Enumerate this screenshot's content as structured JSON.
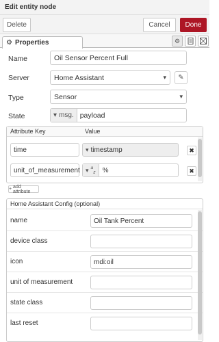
{
  "header": {
    "title": "Edit entity node"
  },
  "toolbar": {
    "delete_label": "Delete",
    "cancel_label": "Cancel",
    "done_label": "Done"
  },
  "tabs": {
    "properties_label": "Properties",
    "properties_icon": "gear-icon"
  },
  "form": {
    "name": {
      "label": "Name",
      "value": "Oil Sensor Percent Full"
    },
    "server": {
      "label": "Server",
      "value": "Home Assistant"
    },
    "type": {
      "label": "Type",
      "value": "Sensor"
    },
    "state": {
      "label": "State",
      "type_tag": "msg.",
      "value": "payload"
    }
  },
  "attributes": {
    "col_key": "Attribute Key",
    "col_value": "Value",
    "rows": [
      {
        "key": "time",
        "type_tag": "",
        "value": "timestamp"
      },
      {
        "key": "unit_of_measurement",
        "type_tag": "a z",
        "value": "%"
      }
    ],
    "add_label": "add attribute"
  },
  "ha_config": {
    "title": "Home Assistant Config (optional)",
    "rows": [
      {
        "label": "name",
        "value": "Oil Tank Percent"
      },
      {
        "label": "device class",
        "value": ""
      },
      {
        "label": "icon",
        "value": "mdi:oil"
      },
      {
        "label": "unit of measurement",
        "value": ""
      },
      {
        "label": "state class",
        "value": ""
      },
      {
        "label": "last reset",
        "value": ""
      }
    ]
  },
  "colors": {
    "done_bg": "#ad1625",
    "tray_bg": "#f3f3f3",
    "border": "#cccccc"
  }
}
